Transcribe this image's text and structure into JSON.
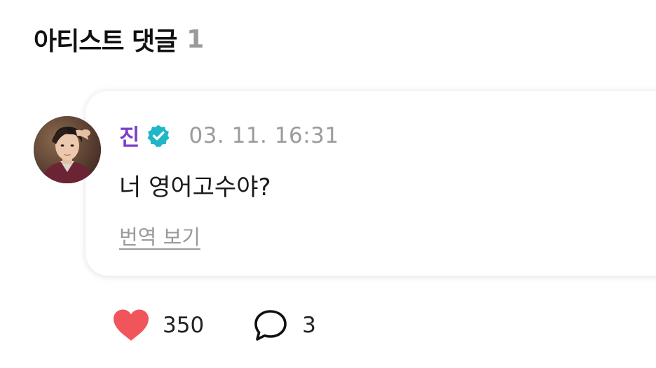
{
  "header": {
    "title": "아티스트 댓글",
    "count": "1"
  },
  "comment": {
    "avatar_icon": "artist-avatar",
    "author": "진",
    "author_color": "#7d3fc6",
    "verified_icon": "verified-badge-icon",
    "verified_color": "#1fb6c8",
    "timestamp": "03. 11. 16:31",
    "text": "너 영어고수야?",
    "translate_label": "번역 보기"
  },
  "actions": {
    "like_icon": "heart-icon",
    "like_color": "#f2545b",
    "like_count": "350",
    "reply_icon": "speech-bubble-icon",
    "reply_count": "3"
  }
}
